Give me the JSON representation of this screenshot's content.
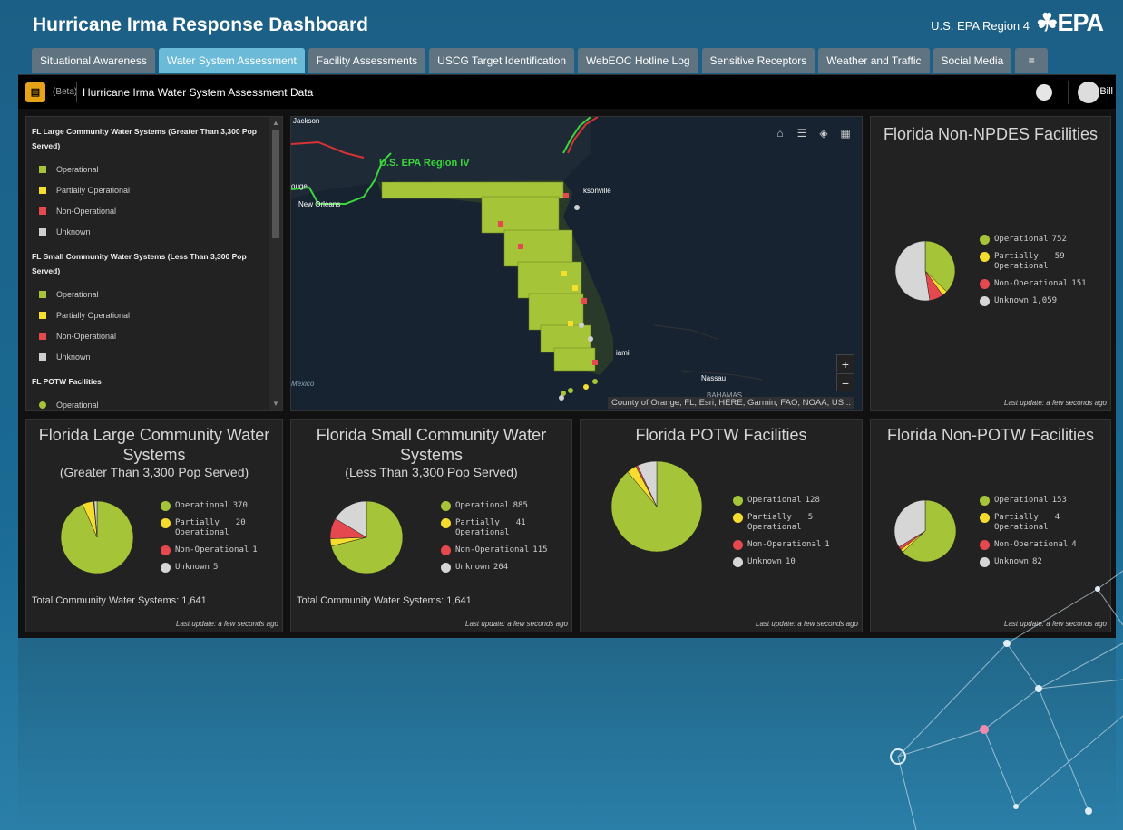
{
  "header": {
    "title": "Hurricane Irma Response Dashboard",
    "region": "U.S. EPA Region 4",
    "logo": "☘EPA"
  },
  "tabs": [
    {
      "label": "Situational Awareness",
      "active": false
    },
    {
      "label": "Water System Assessment",
      "active": true
    },
    {
      "label": "Facility Assessments",
      "active": false
    },
    {
      "label": "USCG Target Identification",
      "active": false
    },
    {
      "label": "WebEOC Hotline Log",
      "active": false
    },
    {
      "label": "Sensitive Receptors",
      "active": false
    },
    {
      "label": "Weather and Traffic",
      "active": false
    },
    {
      "label": "Social Media",
      "active": false
    }
  ],
  "tab_menu_icon": "≡",
  "appbar": {
    "beta": "(Beta)",
    "title": "Hurricane Irma Water System Assessment Data",
    "user": "Bill"
  },
  "legend": {
    "sections": [
      {
        "heading": "FL Large Community Water Systems (Greater Than 3,300 Pop Served)",
        "items": [
          {
            "label": "Operational",
            "color": "#a6c438"
          },
          {
            "label": "Partially Operational",
            "color": "#f3df2c"
          },
          {
            "label": "Non-Operational",
            "color": "#e6484f"
          },
          {
            "label": "Unknown",
            "color": "#cfcfcf"
          }
        ]
      },
      {
        "heading": "FL Small Community Water Systems (Less Than 3,300 Pop Served)",
        "items": [
          {
            "label": "Operational",
            "color": "#a6c438"
          },
          {
            "label": "Partially Operational",
            "color": "#f3df2c"
          },
          {
            "label": "Non-Operational",
            "color": "#e6484f"
          },
          {
            "label": "Unknown",
            "color": "#cfcfcf"
          }
        ]
      },
      {
        "heading": "FL POTW Facilities",
        "items": [
          {
            "label": "Operational",
            "color": "#a6c438"
          }
        ]
      }
    ]
  },
  "map": {
    "labels": {
      "region": "U.S. EPA Region IV",
      "jackson": "Jackson",
      "baton_rouge": "ouge",
      "new_orleans": "New Orleans",
      "jacksonville": "ksonville",
      "miami": "iami",
      "mexico": "Mexico",
      "nassau": "Nassau",
      "bahamas": "BAHAMAS"
    },
    "attribution": "County of Orange, FL, Esri, HERE, Garmin, FAO, NOAA, US...",
    "tools": [
      "home-icon",
      "list-icon",
      "layers-icon",
      "qr-icon"
    ],
    "zoom_in": "+",
    "zoom_out": "−"
  },
  "status_labels": {
    "operational": "Operational",
    "partial_a": "Partially",
    "partial_b": "Operational",
    "non_operational": "Non-Operational",
    "unknown": "Unknown"
  },
  "colors": {
    "operational": "#a6c438",
    "partial": "#f5dc2d",
    "non_operational": "#e6484f",
    "unknown": "#d6d6d6"
  },
  "last_update": "Last update: a few seconds ago",
  "panels": {
    "non_npdes": {
      "title": "Florida Non-NPDES Facilities",
      "values": {
        "operational": "752",
        "partial": "59",
        "non_operational": "151",
        "unknown": "1,059"
      }
    },
    "large_cws": {
      "title": "Florida Large Community Water Systems",
      "subtitle": "(Greater Than 3,300 Pop Served)",
      "total": "Total Community Water Systems: 1,641",
      "values": {
        "operational": "370",
        "partial": "20",
        "non_operational": "1",
        "unknown": "5"
      }
    },
    "small_cws": {
      "title": "Florida Small Community Water Systems",
      "subtitle": "(Less Than 3,300 Pop Served)",
      "total": "Total Community Water Systems: 1,641",
      "values": {
        "operational": "885",
        "partial": "41",
        "non_operational": "115",
        "unknown": "204"
      }
    },
    "potw": {
      "title": "Florida POTW Facilities",
      "values": {
        "operational": "128",
        "partial": "5",
        "non_operational": "1",
        "unknown": "10"
      }
    },
    "non_potw": {
      "title": "Florida Non-POTW Facilities",
      "values": {
        "operational": "153",
        "partial": "4",
        "non_operational": "4",
        "unknown": "82"
      }
    }
  },
  "chart_data": [
    {
      "type": "pie",
      "categories": [
        "Operational",
        "Partially Operational",
        "Non-Operational",
        "Unknown"
      ],
      "values": [
        752,
        59,
        151,
        1059
      ],
      "title": "Florida Non-NPDES Facilities"
    },
    {
      "type": "pie",
      "categories": [
        "Operational",
        "Partially Operational",
        "Non-Operational",
        "Unknown"
      ],
      "values": [
        370,
        20,
        1,
        5
      ],
      "title": "Florida Large Community Water Systems",
      "subtitle": "(Greater Than 3,300 Pop Served)"
    },
    {
      "type": "pie",
      "categories": [
        "Operational",
        "Partially Operational",
        "Non-Operational",
        "Unknown"
      ],
      "values": [
        885,
        41,
        115,
        204
      ],
      "title": "Florida Small Community Water Systems",
      "subtitle": "(Less Than 3,300 Pop Served)"
    },
    {
      "type": "pie",
      "categories": [
        "Operational",
        "Partially Operational",
        "Non-Operational",
        "Unknown"
      ],
      "values": [
        128,
        5,
        1,
        10
      ],
      "title": "Florida POTW Facilities"
    },
    {
      "type": "pie",
      "categories": [
        "Operational",
        "Partially Operational",
        "Non-Operational",
        "Unknown"
      ],
      "values": [
        153,
        4,
        4,
        82
      ],
      "title": "Florida Non-POTW Facilities"
    }
  ]
}
